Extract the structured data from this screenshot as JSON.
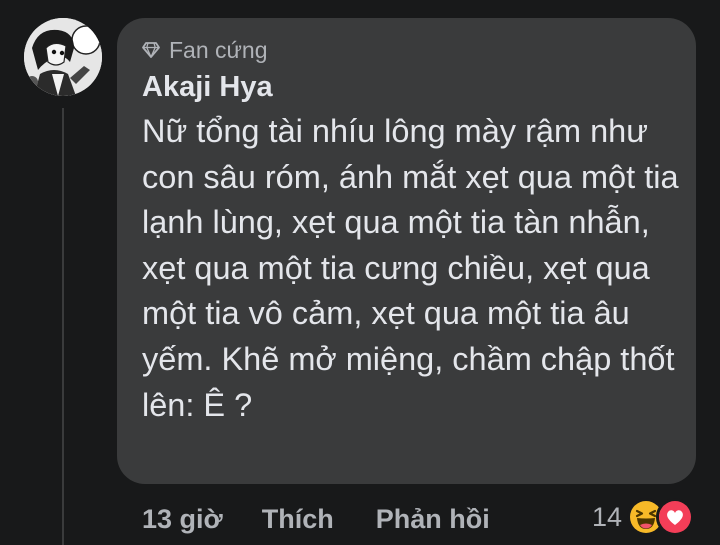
{
  "comment": {
    "badge_label": "Fan cứng",
    "badge_icon": "diamond-icon",
    "author": "Akaji Hya",
    "text": "Nữ tổng tài nhíu lông mày rậm như con sâu róm, ánh mắt xẹt qua một tia lạnh lùng, xẹt qua một tia tàn nhẫn, xẹt qua một tia cưng chiều, xẹt qua một tia vô cảm, xẹt qua một tia âu yếm. Khẽ mở miệng, chầm chập thốt lên: Ê ?",
    "timestamp": "13 giờ",
    "like_label": "Thích",
    "reply_label": "Phản hồi",
    "reaction_count": "14",
    "reaction_icons": [
      "haha-icon",
      "love-icon"
    ]
  },
  "colors": {
    "background": "#18191a",
    "bubble": "#3a3b3c",
    "primary_text": "#e4e6eb",
    "secondary_text": "#b0b3b8",
    "haha": "#f7b928",
    "love": "#f33e58"
  }
}
